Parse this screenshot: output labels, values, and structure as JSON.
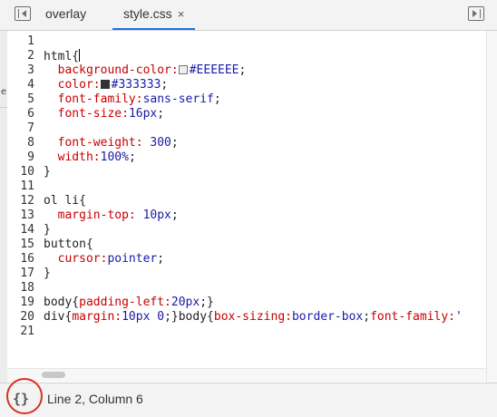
{
  "tabs": [
    {
      "label": "overlay"
    },
    {
      "label": "style.css",
      "close": "×"
    }
  ],
  "status": {
    "format_icon": "{}",
    "position": "Line 2, Column 6"
  },
  "editor": {
    "line_numbers": [
      "1",
      "2",
      "3",
      "4",
      "5",
      "6",
      "7",
      "8",
      "9",
      "10",
      "11",
      "12",
      "13",
      "14",
      "15",
      "16",
      "17",
      "18",
      "19",
      "20",
      "21"
    ],
    "lines": [
      "",
      "html{",
      "  background-color: #EEEEEE;",
      "  color: #333333;",
      "  font-family:sans-serif;",
      "  font-size:16px;",
      "",
      "  font-weight: 300;",
      "  width:100%;",
      "}",
      "",
      "ol li{",
      "  margin-top: 10px;",
      "}",
      "button{",
      "  cursor:pointer;",
      "}",
      "",
      "body{padding-left:20px;}",
      "div{margin:10px 0;}body{box-sizing:border-box;font-family:'",
      ""
    ],
    "swatches": [
      "#EEEEEE",
      "#333333"
    ]
  },
  "icons": {
    "left_panel_toggle": "panel-left-icon",
    "right_panel_toggle": "panel-right-icon",
    "format": "pretty-print-icon"
  }
}
